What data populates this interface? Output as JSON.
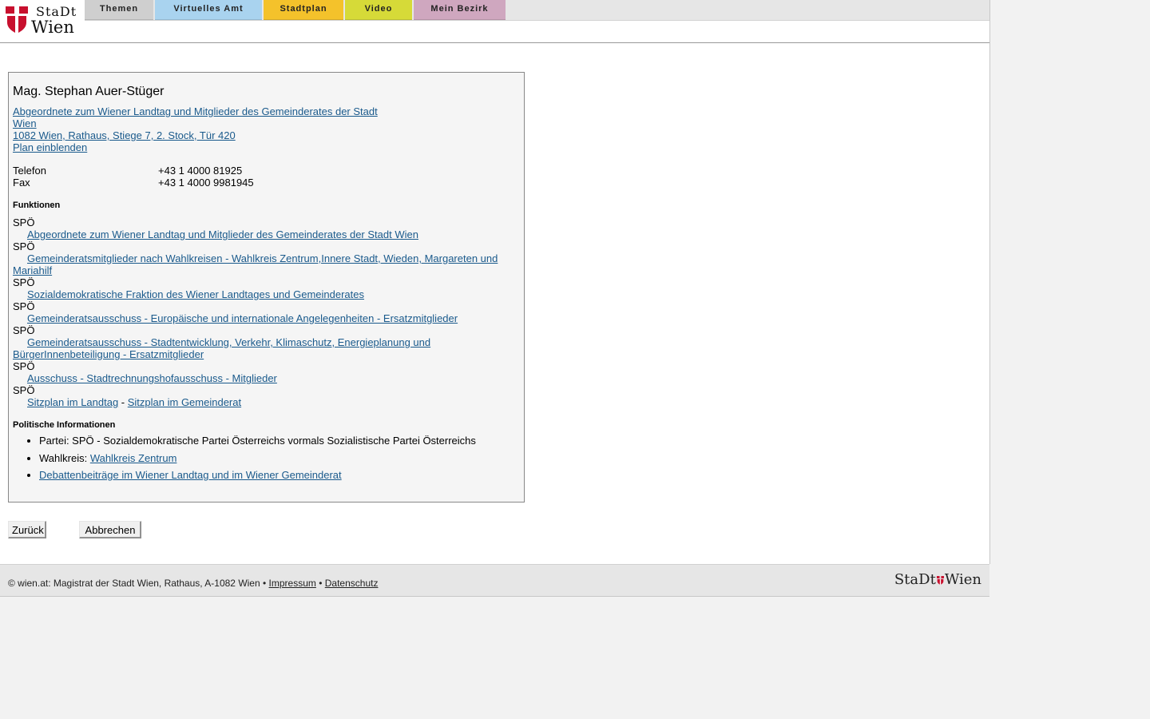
{
  "brand": {
    "line1": "StaDt",
    "line2": "Wien",
    "footer_left": "StaDt",
    "footer_right": "Wien"
  },
  "colors": {
    "tab_themen": "#cfcfcf",
    "tab_amt": "#a9d3ef",
    "tab_stadtplan": "#f4c22b",
    "tab_video": "#d6da38",
    "tab_bezirk": "#cfa7bf",
    "link": "#1a5a8c",
    "flag_red": "#c8102e"
  },
  "nav": {
    "themen": "Themen",
    "virtuelles_amt": "Virtuelles Amt",
    "stadtplan": "Stadtplan",
    "video": "Video",
    "mein_bezirk": "Mein Bezirk"
  },
  "person": {
    "name": "Mag. Stephan Auer-Stüger",
    "org_line1": "Abgeordnete zum Wiener Landtag und Mitglieder des Gemeinderates der Stadt",
    "org_line2": "Wien ",
    "address": "1082 Wien, Rathaus, Stiege 7, 2. Stock, Tür 420",
    "plan_link": "Plan einblenden"
  },
  "contact": {
    "phone_label": "Telefon",
    "phone_value": "+43 1 4000 81925",
    "fax_label": "Fax",
    "fax_value": "+43 1 4000 9981945"
  },
  "functions": {
    "heading": "Funktionen",
    "party": "SPÖ",
    "f1": "Abgeordnete zum Wiener Landtag und Mitglieder des Gemeinderates der Stadt Wien",
    "f2a": "Gemeinderatsmitglieder nach Wahlkreisen - Wahlkreis Zentrum,Innere Stadt, Wieden, Margareten und",
    "f2b": "Mariahilf",
    "f3": "Sozialdemokratische Fraktion des Wiener Landtages und Gemeinderates",
    "f4": "Gemeinderatsausschuss - Europäische und internationale Angelegenheiten - Ersatzmitglieder",
    "f5a": "Gemeinderatsausschuss - Stadtentwicklung, Verkehr, Klimaschutz, Energieplanung und",
    "f5b": "BürgerInnenbeteiligung - Ersatzmitglieder",
    "f6": "Ausschuss - Stadtrechnungshofausschuss - Mitglieder",
    "f7a": "Sitzplan im Landtag",
    "f7sep": " - ",
    "f7b": "Sitzplan im Gemeinderat"
  },
  "political": {
    "heading": "Politische Informationen",
    "party_text": "Partei: SPÖ - Sozialdemokratische Partei Österreichs vormals Sozialistische Partei Österreichs",
    "district_label": "Wahlkreis: ",
    "district_link": "Wahlkreis Zentrum",
    "debates_link": "Debattenbeiträge im Wiener Landtag und im Wiener Gemeinderat"
  },
  "buttons": {
    "back": "Zurück",
    "cancel": "Abbrechen"
  },
  "footer": {
    "text": "© wien.at: Magistrat der Stadt Wien, Rathaus, A-1082 Wien • ",
    "impressum": "Impressum",
    "sep": " • ",
    "datenschutz": "Datenschutz"
  }
}
